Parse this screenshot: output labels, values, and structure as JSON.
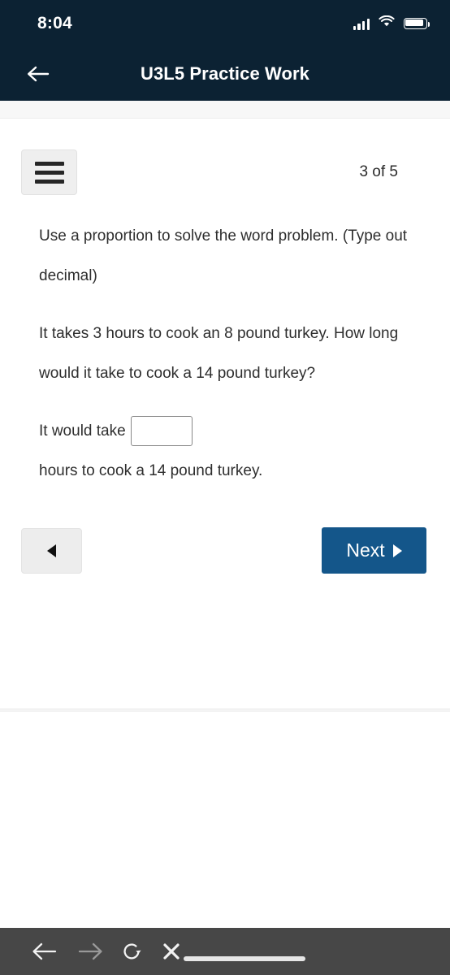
{
  "status_bar": {
    "time": "8:04",
    "signal_icon": "cellular-signal-icon",
    "wifi_icon": "wifi-icon",
    "battery_icon": "battery-full-icon"
  },
  "app_header": {
    "back_icon": "arrow-left-icon",
    "title": "U3L5 Practice Work",
    "background_color": "#0c2233"
  },
  "toolbar": {
    "menu_icon": "hamburger-menu-icon",
    "page_counter": "3 of 5",
    "current_page": 3,
    "total_pages": 5
  },
  "question": {
    "instruction": "Use a proportion to solve the word problem. (Type out decimal)",
    "problem": "It takes 3 hours to cook an 8 pound turkey.  How long would it take to cook a 14 pound turkey?",
    "answer_prefix": "It would take",
    "answer_suffix": "hours to cook a 14 pound turkey.",
    "answer_value": "",
    "answer_placeholder": ""
  },
  "navigation": {
    "prev_icon": "triangle-left-icon",
    "prev_label": "",
    "next_label": "Next",
    "next_icon": "triangle-right-icon",
    "next_color": "#14568a"
  },
  "browser_bar": {
    "back_icon": "arrow-left-icon",
    "forward_icon": "arrow-right-icon",
    "reload_icon": "reload-icon",
    "close_icon": "close-x-icon",
    "url_bar_label": "",
    "background_color": "#474747"
  }
}
